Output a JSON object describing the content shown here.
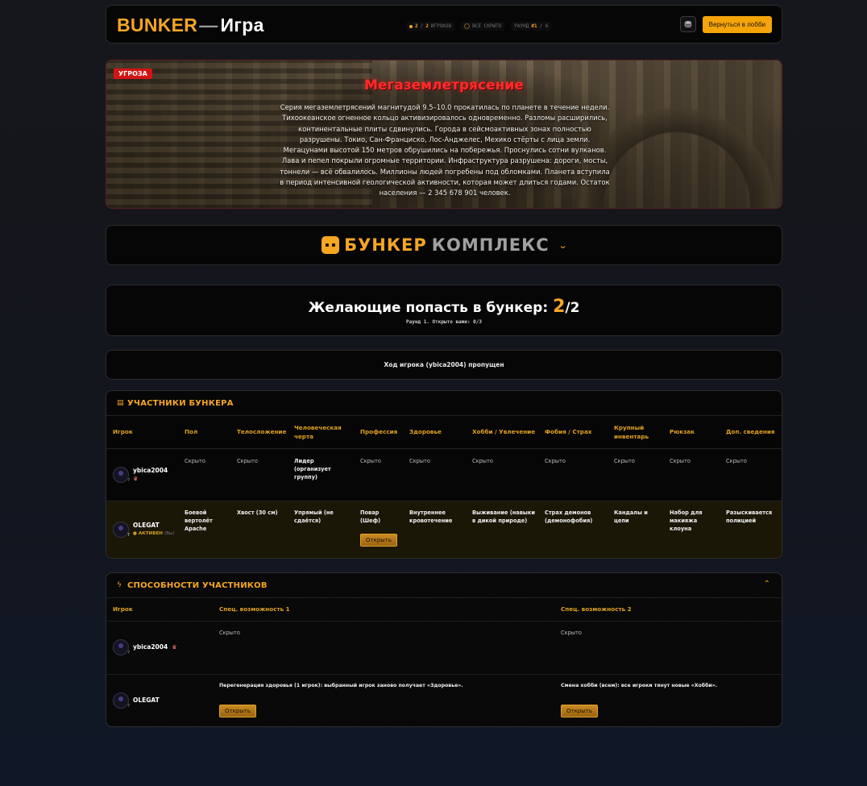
{
  "header": {
    "logo_brand": "BUNKER",
    "logo_sep": "—",
    "logo_game": "Игра",
    "stats": [
      {
        "value": "2",
        "sep": "/",
        "total": "2",
        "label": "ИГРОКОВ"
      },
      {
        "label": "ВСЕ СКРЫТО"
      },
      {
        "label": "РАУНД",
        "value": "#1",
        "suffix": "/ 6"
      }
    ],
    "settings_icon": "bunker-settings-icon",
    "lobby_button": "Вернуться в лобби"
  },
  "threat": {
    "badge": "УГРОЗА",
    "title": "Мегаземлетрясение",
    "text": "Серия мегаземлетрясений магнитудой 9.5–10.0 прокатилась по планете в течение недели. Тихоокеанское огненное кольцо активизировалось одновременно. Разломы расширились, континентальные плиты сдвинулись. Города в сейсмоактивных зонах полностью разрушены. Токио, Сан-Франциско, Лос-Анджелес, Мехико стёрты с лица земли. Мегацунами высотой 150 метров обрушились на побережья. Проснулись сотни вулканов. Лава и пепел покрыли огромные территории. Инфраструктура разрушена: дороги, мосты, тоннели — всё обвалилось. Миллионы людей погребены под обломками. Планета вступила в период интенсивной геологической активности, которая может длиться годами. Остаток населения — 2 345 678 901 человек."
  },
  "complex": {
    "word1": "БУНКЕР",
    "word2": "КОМПЛЕКС"
  },
  "applicants": {
    "title": "Желающие попасть в бункер:",
    "count": "2",
    "total": "/2",
    "subtitle": "Раунд 1. Открыто вами: 0/3"
  },
  "turn": {
    "text": "Ход игрока (ybica2004) пропущен"
  },
  "participants": {
    "title": "УЧАСТНИКИ БУНКЕРА",
    "columns": [
      "Игрок",
      "Пол",
      "Телосложение",
      "Человеческая черта",
      "Профессия",
      "Здоровье",
      "Хобби / Увлечение",
      "Фобия / Страх",
      "Крупный инвентарь",
      "Рюкзак",
      "Доп. сведения"
    ],
    "rows": [
      {
        "name": "ybica2004",
        "crown": "♛",
        "cells": [
          "Скрыто",
          "Скрыто",
          "Лидер (организует группу)",
          "Скрыто",
          "Скрыто",
          "Скрыто",
          "Скрыто",
          "Скрыто",
          "Скрыто",
          "Скрыто"
        ]
      },
      {
        "name": "OLEGAT",
        "status": "● АКТИВЕН",
        "status_dim": "(Вы)",
        "cells": [
          "Боевой вертолёт Apache",
          "Хвост (30 см)",
          "Упрямый (не сдаётся)",
          "Повар (Шеф)",
          "Внутреннее кровотечение",
          "Выживание (навыки в дикой природе)",
          "Страх демонов (демонофобия)",
          "Кандалы и цепи",
          "Набор для макияжа клоуна",
          "Разыскивается полицией"
        ],
        "open_button": "Открыть"
      }
    ]
  },
  "abilities": {
    "title": "СПОСОБНОСТИ УЧАСТНИКОВ",
    "columns": [
      "Игрок",
      "Спец. возможность 1",
      "Спец. возможность 2"
    ],
    "rows": [
      {
        "name": "ybica2004",
        "crown": "♛",
        "a1": "Скрыто",
        "a2": "Скрыто"
      },
      {
        "name": "OLEGAT",
        "a1": "Перегенерация здоровья (1 игрок): выбранный игрок заново получает «Здоровье».",
        "a2": "Смена хобби (всем): все игроки тянут новые «Хобби».",
        "open1": "Открыть",
        "open2": "Открыть"
      }
    ]
  },
  "colors": {
    "accent": "#f5a623",
    "threat": "#ff2a2a",
    "badge": "#d41414",
    "active_row": "#1b1707"
  }
}
